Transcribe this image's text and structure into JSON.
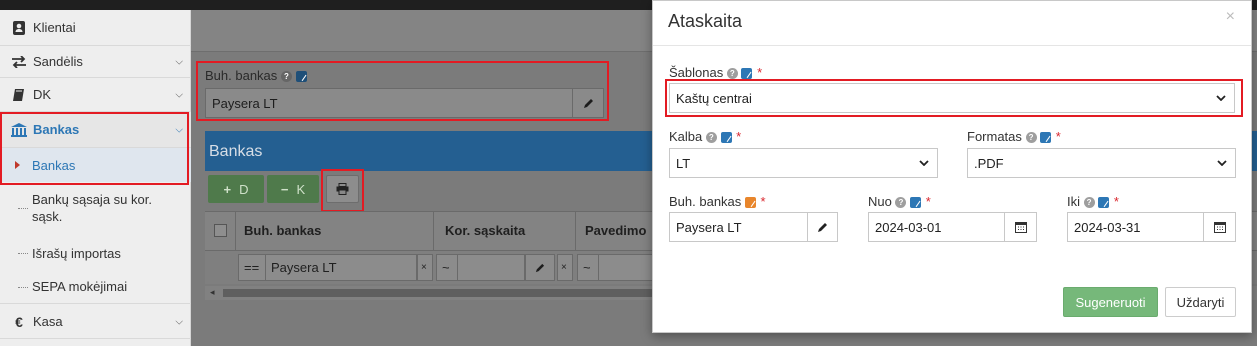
{
  "sidebar": {
    "items": [
      {
        "label": "Klientai"
      },
      {
        "label": "Sandėlis"
      },
      {
        "label": "DK"
      },
      {
        "label": "Bankas"
      },
      {
        "label": "Kasa"
      }
    ],
    "bank_subitems": [
      {
        "label": "Bankas"
      },
      {
        "label": "Bankų sąsaja su kor. sąsk."
      },
      {
        "label": "Išrašų importas"
      },
      {
        "label": "SEPA mokėjimai"
      }
    ]
  },
  "main": {
    "buh_bankas_label": "Buh. bankas",
    "buh_bankas_value": "Paysera LT",
    "panel_title": "Bankas",
    "toolbar": {
      "debit_label": "D",
      "credit_label": "K"
    },
    "grid": {
      "columns": [
        "Buh. bankas",
        "Kor. sąskaita",
        "Pavedimo"
      ],
      "filter": {
        "op1": "==",
        "value1": "Paysera LT",
        "op2": "~",
        "op3": "~"
      }
    }
  },
  "modal": {
    "title": "Ataskaita",
    "template_label": "Šablonas",
    "template_value": "Kaštų centrai",
    "language_label": "Kalba",
    "language_value": "LT",
    "format_label": "Formatas",
    "format_value": ".PDF",
    "bank_label": "Buh. bankas",
    "bank_value": "Paysera LT",
    "from_label": "Nuo",
    "from_value": "2024-03-01",
    "to_label": "Iki",
    "to_value": "2024-03-31",
    "generate_label": "Sugeneruoti",
    "close_label": "Uždaryti",
    "required_mark": "*"
  },
  "colors": {
    "accent": "#2d77b5",
    "highlight": "#e31b23",
    "generate_button": "#76b87a"
  }
}
